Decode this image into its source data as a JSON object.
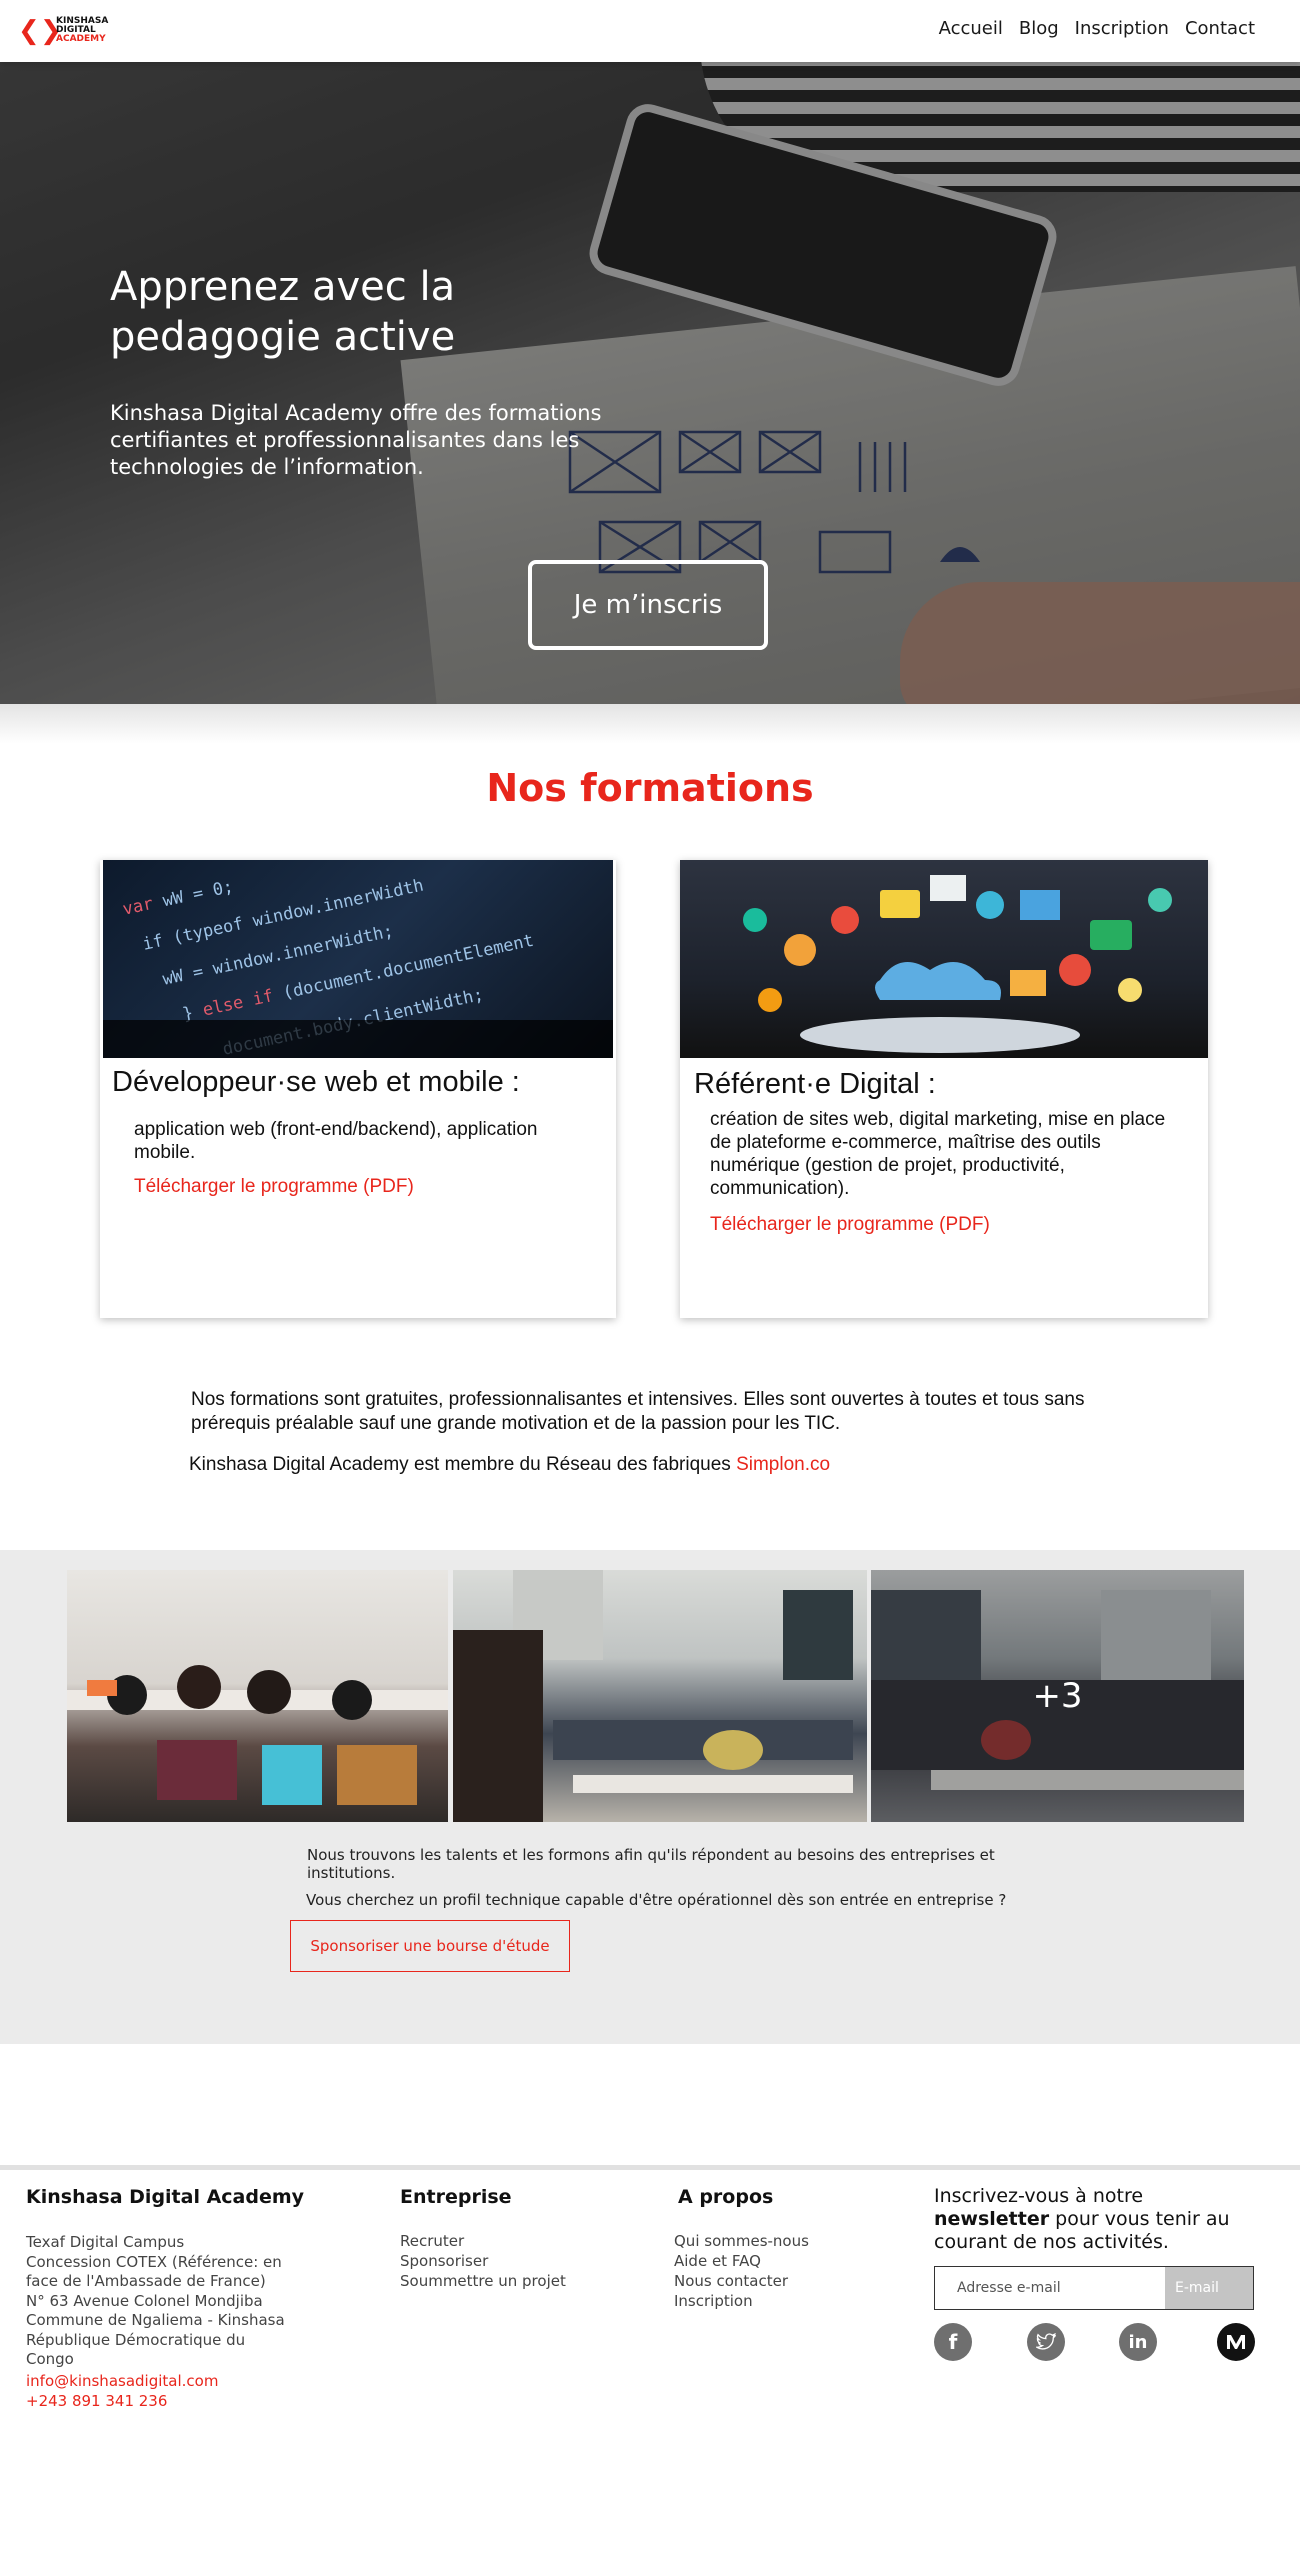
{
  "header": {
    "logo": {
      "line1": "KINSHASA",
      "line2": "DIGITAL",
      "line3": "ACADEMY"
    },
    "nav": [
      "Accueil",
      "Blog",
      "Inscription",
      "Contact"
    ]
  },
  "hero": {
    "title": "Apprenez avec la pedagogie active",
    "text": "Kinshasa Digital Academy offre des formations certifiantes et proffessionnalisantes dans les technologies de l’information.",
    "cta": "Je m’inscris"
  },
  "formations": {
    "title": "Nos formations",
    "cards": [
      {
        "title": "Développeur·se web et mobile :",
        "description": "application web (front-end/backend), application mobile.",
        "link": "Télécharger le programme (PDF)"
      },
      {
        "title": "Référent·e Digital :",
        "description": "création de sites web, digital marketing, mise en place de plateforme e-commerce, maîtrise des outils numérique (gestion de projet, productivité, communication).",
        "link": "Télécharger le programme (PDF)"
      }
    ],
    "paragraph": "Nos formations sont gratuites, professionnalisantes et intensives. Elles sont ouvertes à toutes et tous sans prérequis préalable sauf une grande motivation et de la passion pour les TIC.",
    "member_prefix": "Kinshasa Digital Academy est membre du Réseau des fabriques",
    "member_link": "Simplon.co"
  },
  "gallery": {
    "more_label": "+3",
    "sponsor_text1": "Nous trouvons les talents et les formons afin qu'ils répondent au besoins des entreprises et institutions.",
    "sponsor_text2": "Vous cherchez un profil technique capable d'être opérationnel dès son entrée en entreprise ?",
    "sponsor_button": "Sponsoriser une bourse d'étude"
  },
  "footer": {
    "col1_title": "Kinshasa Digital Academy",
    "address": [
      "Texaf Digital Campus",
      "Concession COTEX (Référence: en",
      "face de l'Ambassade de France)",
      "N° 63 Avenue Colonel Mondjiba",
      "Commune de Ngaliema - Kinshasa",
      "République Démocratique du",
      "Congo"
    ],
    "email": "info@kinshasadigital.com",
    "phone": "+243 891 341 236",
    "col2_title": "Entreprise",
    "entreprise_links": [
      "Recruter",
      "Sponsoriser",
      "Soummettre un projet"
    ],
    "col3_title": "A propos",
    "apropos_links": [
      "Qui sommes-nous",
      "Aide et FAQ",
      "Nous contacter",
      "Inscription"
    ],
    "newsletter_prefix": "Inscrivez-vous à notre",
    "newsletter_bold": "newsletter",
    "newsletter_suffix": "pour vous tenir au courant de nos activités.",
    "newsletter_placeholder": "Adresse e-mail",
    "newsletter_button": "E-mail",
    "social": [
      "facebook-icon",
      "twitter-icon",
      "linkedin-icon",
      "medium-icon"
    ]
  },
  "colors": {
    "accent": "#e8261c",
    "band": "#ebebeb",
    "social": "#6f6f6f"
  }
}
